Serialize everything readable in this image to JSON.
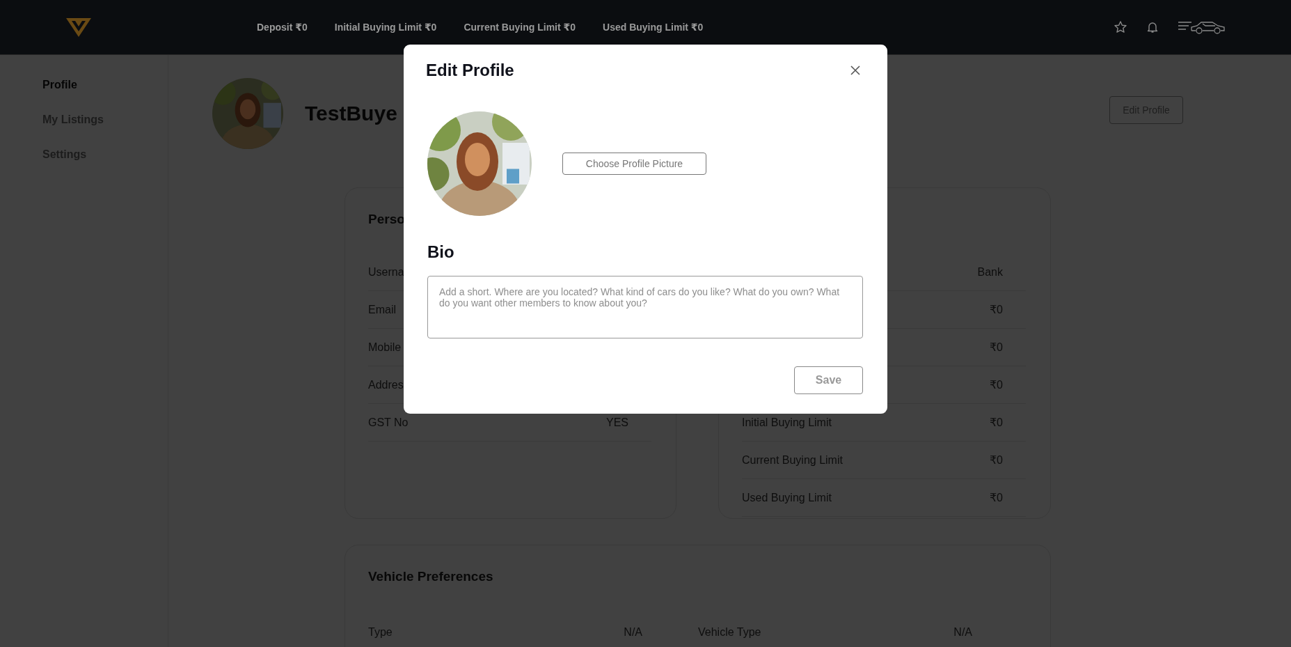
{
  "header": {
    "stats": [
      "Deposit ₹0",
      "Initial Buying Limit ₹0",
      "Current Buying Limit ₹0",
      "Used Buying Limit ₹0"
    ]
  },
  "sidebar": {
    "items": [
      {
        "label": "Profile",
        "selected": true
      },
      {
        "label": "My Listings",
        "selected": false
      },
      {
        "label": "Settings",
        "selected": false
      }
    ]
  },
  "profile": {
    "name": "TestBuye",
    "edit_button": "Edit Profile"
  },
  "personal_card": {
    "title": "Perso",
    "rows": [
      {
        "label": "Userna"
      },
      {
        "label": "Email"
      },
      {
        "label": "Mobile"
      },
      {
        "label": "Addres"
      },
      {
        "label": "GST No",
        "value": "YES"
      }
    ]
  },
  "limits_card": {
    "rows": [
      {
        "value": "Bank"
      },
      {
        "value": "₹0"
      },
      {
        "value": "₹0"
      },
      {
        "value": "₹0"
      },
      {
        "label": "Initial Buying Limit",
        "value": "₹0"
      },
      {
        "label": "Current Buying Limit",
        "value": "₹0"
      },
      {
        "label": "Used Buying Limit",
        "value": "₹0"
      }
    ]
  },
  "vehicle_card": {
    "title": "Vehicle Preferences",
    "rows": [
      {
        "label": "Type",
        "value": "N/A"
      },
      {
        "label": "Vehicle Type",
        "value": "N/A"
      }
    ]
  },
  "modal": {
    "title": "Edit Profile",
    "choose_button": "Choose Profile Picture",
    "bio_label": "Bio",
    "bio_placeholder": "Add a short. Where are you located? What kind of cars do you like? What do you own? What do you want other members to know about you?",
    "save_button": "Save"
  }
}
